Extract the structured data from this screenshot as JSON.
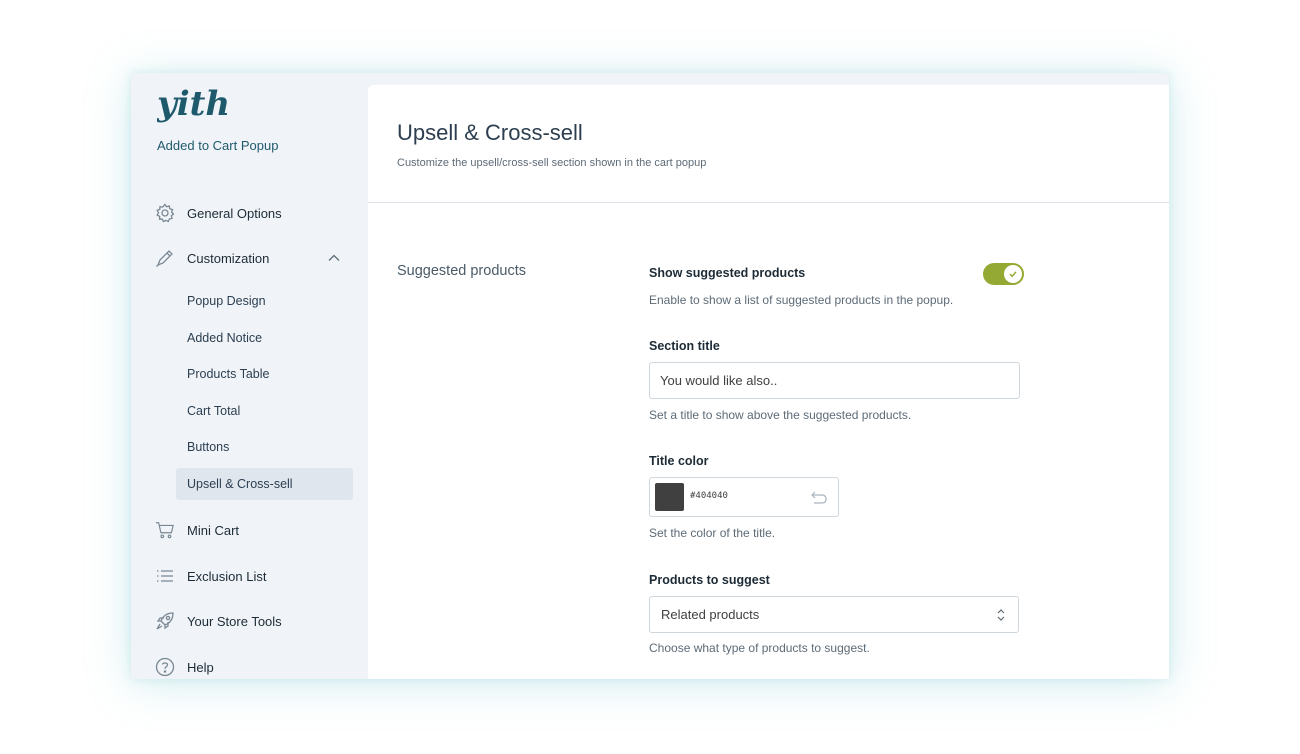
{
  "sidebar": {
    "logo_text": "yith",
    "plugin_name": "Added to Cart Popup",
    "items": [
      {
        "label": "General Options",
        "icon": "gear-icon"
      },
      {
        "label": "Customization",
        "icon": "pen-icon",
        "expanded": true
      },
      {
        "label": "Mini Cart",
        "icon": "cart-icon"
      },
      {
        "label": "Exclusion List",
        "icon": "list-icon"
      },
      {
        "label": "Your Store Tools",
        "icon": "rocket-icon"
      },
      {
        "label": "Help",
        "icon": "help-icon"
      }
    ],
    "sub_items": [
      {
        "label": "Popup Design"
      },
      {
        "label": "Added Notice"
      },
      {
        "label": "Products Table"
      },
      {
        "label": "Cart Total"
      },
      {
        "label": "Buttons"
      },
      {
        "label": "Upsell & Cross-sell",
        "active": true
      }
    ]
  },
  "main": {
    "title": "Upsell & Cross-sell",
    "subtitle": "Customize the upsell/cross-sell section shown in the cart popup",
    "section_label": "Suggested products",
    "fields": {
      "show_suggested": {
        "label": "Show suggested products",
        "description": "Enable to show a list of suggested products in the popup.",
        "enabled": true
      },
      "section_title": {
        "label": "Section title",
        "value": "You would like also..",
        "description": "Set a title to show above the suggested products."
      },
      "title_color": {
        "label": "Title color",
        "value": "#404040",
        "description": "Set the color of the title."
      },
      "products_to_suggest": {
        "label": "Products to suggest",
        "value": "Related products",
        "description": "Choose what type of products to suggest."
      }
    }
  },
  "colors": {
    "accent_green": "#94a834",
    "brand_teal": "#1f5a6c",
    "sidebar_bg": "#f0f4f8",
    "active_item_bg": "#dfe6ee"
  }
}
